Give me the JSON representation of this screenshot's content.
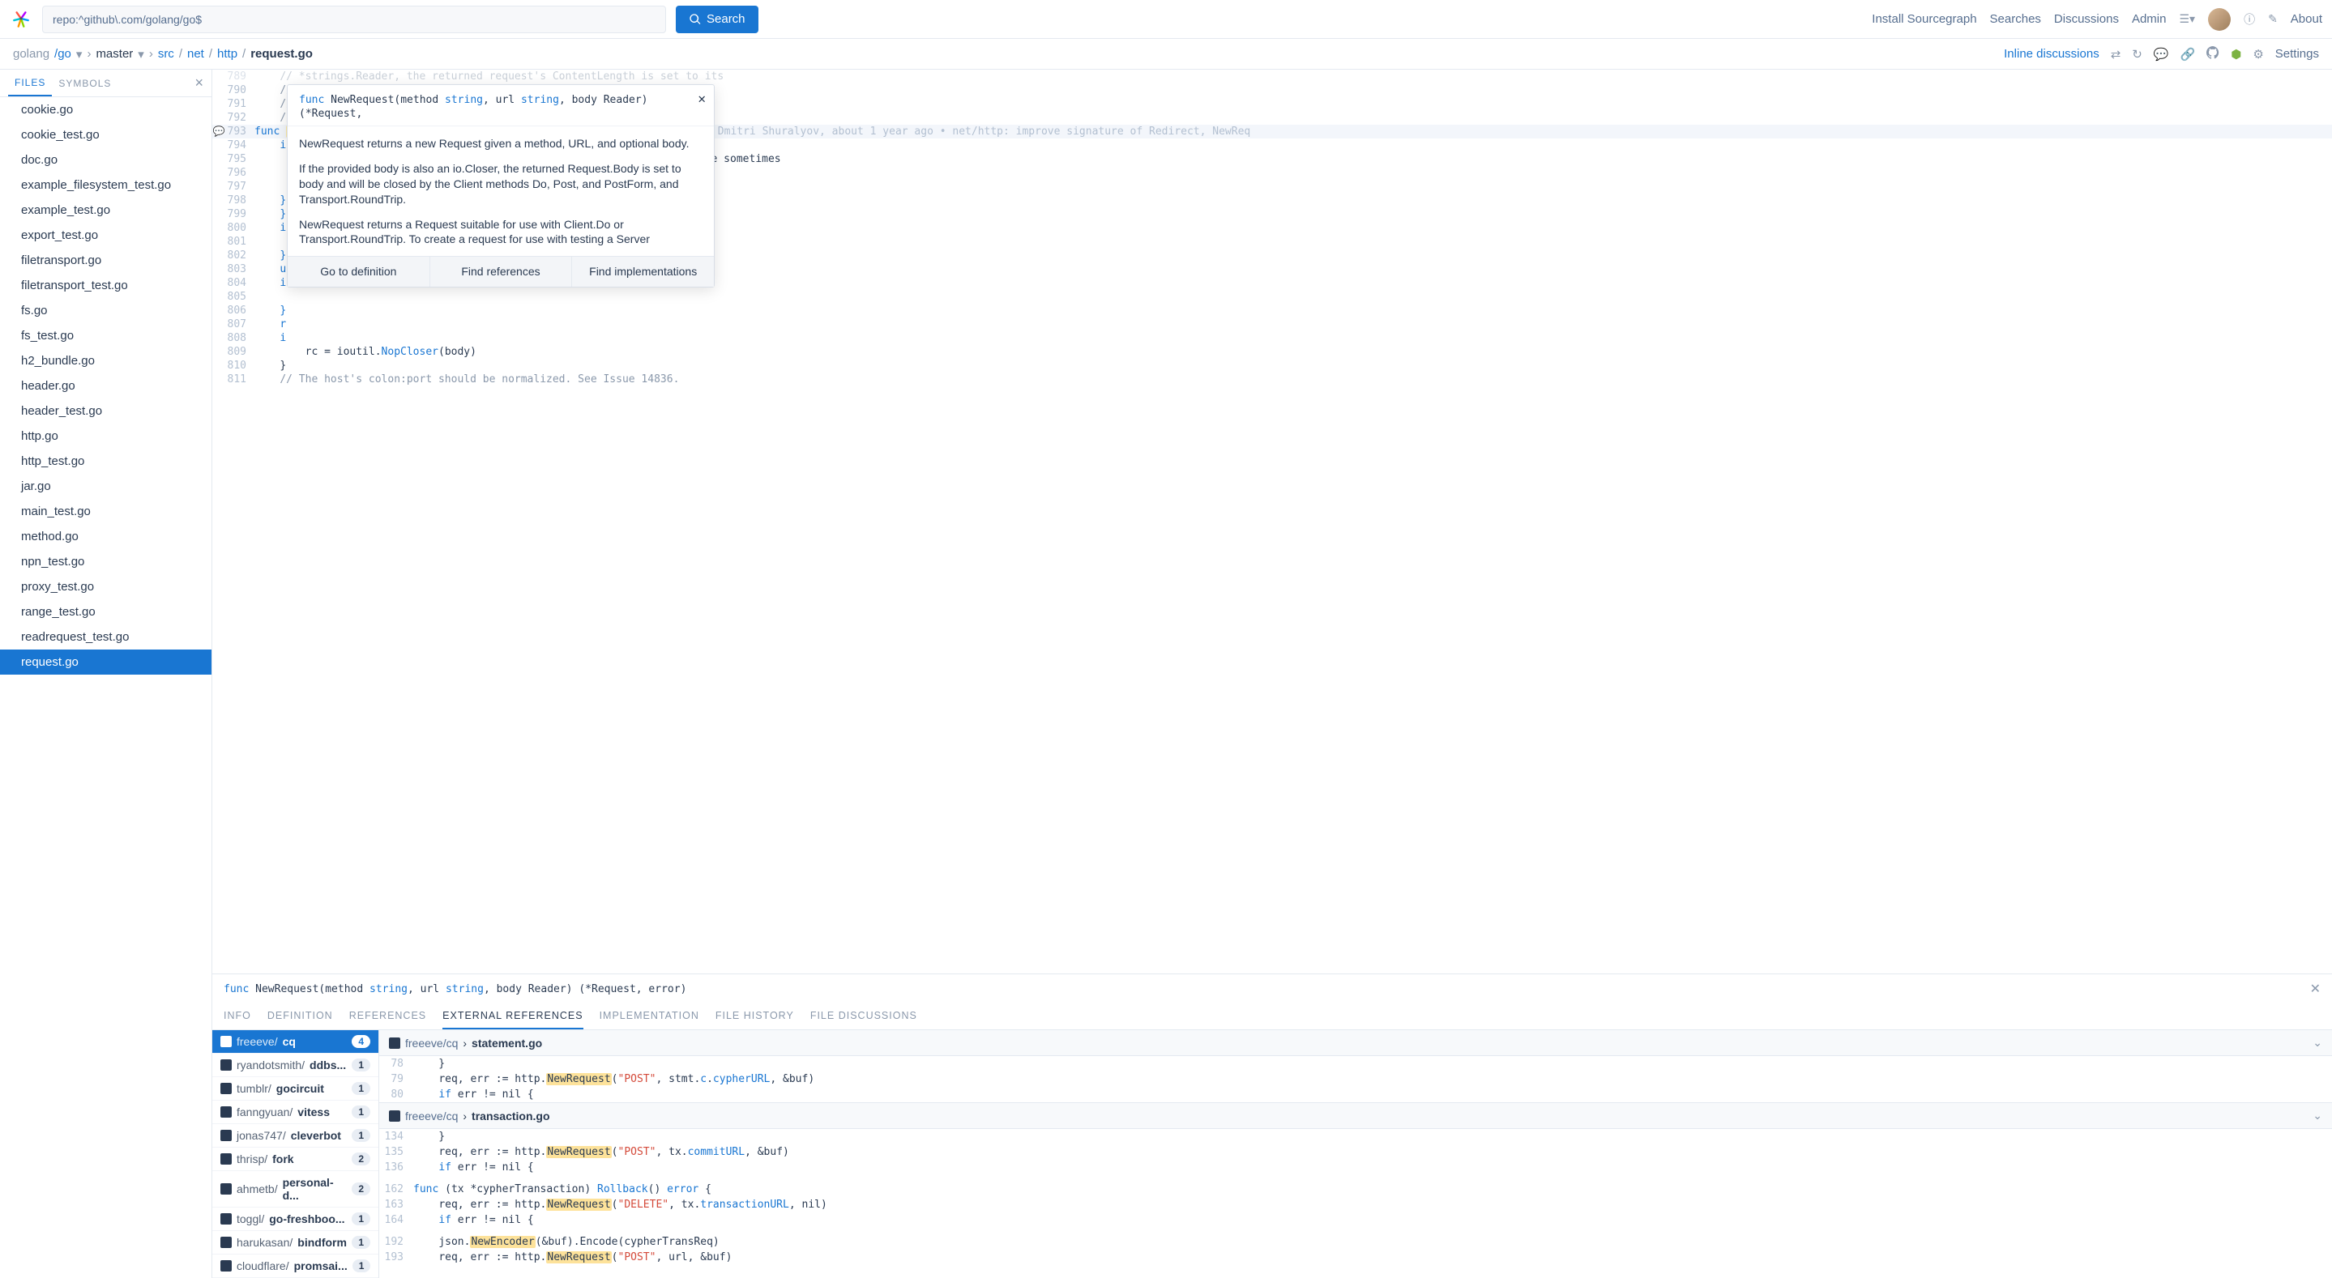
{
  "search": {
    "query": "repo:^github\\.com/golang/go$",
    "button": "Search"
  },
  "topnav": {
    "install": "Install Sourcegraph",
    "searches": "Searches",
    "discussions": "Discussions",
    "admin": "Admin",
    "about": "About"
  },
  "breadcrumb": {
    "owner": "golang",
    "repo": "/go",
    "branch": "master",
    "segs": [
      "src",
      "net",
      "http"
    ],
    "file": "request.go",
    "inline": "Inline discussions",
    "settings": "Settings"
  },
  "side_tabs": {
    "files": "FILES",
    "symbols": "SYMBOLS"
  },
  "files": [
    "cookie.go",
    "cookie_test.go",
    "doc.go",
    "example_filesystem_test.go",
    "example_test.go",
    "export_test.go",
    "filetransport.go",
    "filetransport_test.go",
    "fs.go",
    "fs_test.go",
    "h2_bundle.go",
    "header.go",
    "header_test.go",
    "http.go",
    "http_test.go",
    "jar.go",
    "main_test.go",
    "method.go",
    "npn_test.go",
    "proxy_test.go",
    "range_test.go",
    "readrequest_test.go",
    "request.go"
  ],
  "selected_file_index": 22,
  "code": {
    "start": 789,
    "lines": [
      {
        "t": "// *strings.Reader, the returned request's ContentLength is set to its",
        "cls": "c-comment",
        "faded": true
      },
      {
        "t": "// exact value (instead of -1), GetBody is populated (so 307 and 308",
        "cls": "c-comment"
      },
      {
        "t": "// redirects can replay the body), and Body is set to NoBody if the",
        "cls": "c-comment"
      },
      {
        "t": "// ContentLength is 0.",
        "cls": "c-comment"
      },
      {
        "sig": true,
        "hl": true,
        "icon": "💬",
        "blame": "Dmitri Shuralyov, about 1 year ago • net/http: improve signature of Redirect, NewReq"
      },
      {
        "frag": "if method == \"\" {"
      },
      {
        "frag": "    // We document that \"\" means \"GET\" for Request.Method, and people sometimes"
      },
      {
        "frag": ""
      },
      {
        "frag": ""
      },
      {
        "frag": "}"
      },
      {
        "frag": "}"
      },
      {
        "frag": "i"
      },
      {
        "frag": ""
      },
      {
        "frag": "}"
      },
      {
        "frag": "u"
      },
      {
        "frag": "i"
      },
      {
        "frag": ""
      },
      {
        "frag": "}"
      },
      {
        "frag": "r"
      },
      {
        "frag": "i"
      },
      {
        "t": "    rc = ioutil.NopCloser(body)",
        "nopclose": true
      },
      {
        "t": "}",
        "cls": ""
      },
      {
        "t": "// The host's colon:port should be normalized. See Issue 14836.",
        "cls": "c-comment"
      }
    ],
    "sig_tokens": {
      "func": "func",
      "name": "NewRequest",
      "open": "(",
      "method": "method",
      "c1": ", ",
      "url": "url",
      "space": " ",
      "string": "string",
      "c2": ", ",
      "body": "body",
      "space2": " ",
      "reader": "io.Reader",
      "close": ") (*",
      "req": "Request",
      "c3": ", ",
      "err": "error",
      "end": ") {"
    }
  },
  "hover": {
    "sig_pre": "func NewRequest(method ",
    "sig_str1": "string",
    "sig_mid1": ", url ",
    "sig_str2": "string",
    "sig_mid2": ", body Reader) (*Request,",
    "p1": "NewRequest returns a new Request given a method, URL, and optional body.",
    "p2": "If the provided body is also an io.Closer, the returned Request.Body is set to body and will be closed by the Client methods Do, Post, and PostForm, and Transport.RoundTrip.",
    "p3": "NewRequest returns a Request suitable for use with Client.Do or Transport.RoundTrip. To create a request for use with testing a Server",
    "actions": [
      "Go to definition",
      "Find references",
      "Find implementations"
    ]
  },
  "panel": {
    "sig": "func NewRequest(method string, url string, body Reader) (*Request, error)",
    "tabs": [
      "INFO",
      "DEFINITION",
      "REFERENCES",
      "EXTERNAL REFERENCES",
      "IMPLEMENTATION",
      "FILE HISTORY",
      "FILE DISCUSSIONS"
    ],
    "active_tab": 3,
    "repos": [
      {
        "owner": "freeeve/",
        "name": "cq",
        "count": 4,
        "sel": true
      },
      {
        "owner": "ryandotsmith/",
        "name": "ddbs...",
        "count": 1
      },
      {
        "owner": "tumblr/",
        "name": "gocircuit",
        "count": 1
      },
      {
        "owner": "fanngyuan/",
        "name": "vitess",
        "count": 1
      },
      {
        "owner": "jonas747/",
        "name": "cleverbot",
        "count": 1
      },
      {
        "owner": "thrisp/",
        "name": "fork",
        "count": 2
      },
      {
        "owner": "ahmetb/",
        "name": "personal-d...",
        "count": 2
      },
      {
        "owner": "toggl/",
        "name": "go-freshboo...",
        "count": 1
      },
      {
        "owner": "harukasan/",
        "name": "bindform",
        "count": 1
      },
      {
        "owner": "cloudflare/",
        "name": "promsai...",
        "count": 1
      }
    ],
    "ref_files": [
      {
        "owner": "freeeve/cq",
        "sep": " › ",
        "name": "statement.go",
        "lines": [
          {
            "n": 78,
            "t": "    }"
          },
          {
            "n": 79,
            "t": "    req, err := http.NewRequest(\"POST\", stmt.c.cypherURL, &buf)",
            "hl": "NewRequest"
          },
          {
            "n": 80,
            "t": "    if err != nil {"
          }
        ]
      },
      {
        "owner": "freeeve/cq",
        "sep": " › ",
        "name": "transaction.go",
        "lines": [
          {
            "n": 134,
            "t": "    }"
          },
          {
            "n": 135,
            "t": "    req, err := http.NewRequest(\"POST\", tx.commitURL, &buf)",
            "hl": "NewRequest"
          },
          {
            "n": 136,
            "t": "    if err != nil {"
          },
          {
            "n": 162,
            "t": "func (tx *cypherTransaction) Rollback() error {",
            "gap": true
          },
          {
            "n": 163,
            "t": "    req, err := http.NewRequest(\"DELETE\", tx.transactionURL, nil)",
            "hl": "NewRequest"
          },
          {
            "n": 164,
            "t": "    if err != nil {"
          },
          {
            "n": 192,
            "t": "    json.NewEncoder(&buf).Encode(cypherTransReq)",
            "gap": true,
            "hl": "NewEncoder"
          },
          {
            "n": 193,
            "t": "    req, err := http.NewRequest(\"POST\", url, &buf)",
            "hl": "NewRequest"
          }
        ]
      }
    ]
  }
}
